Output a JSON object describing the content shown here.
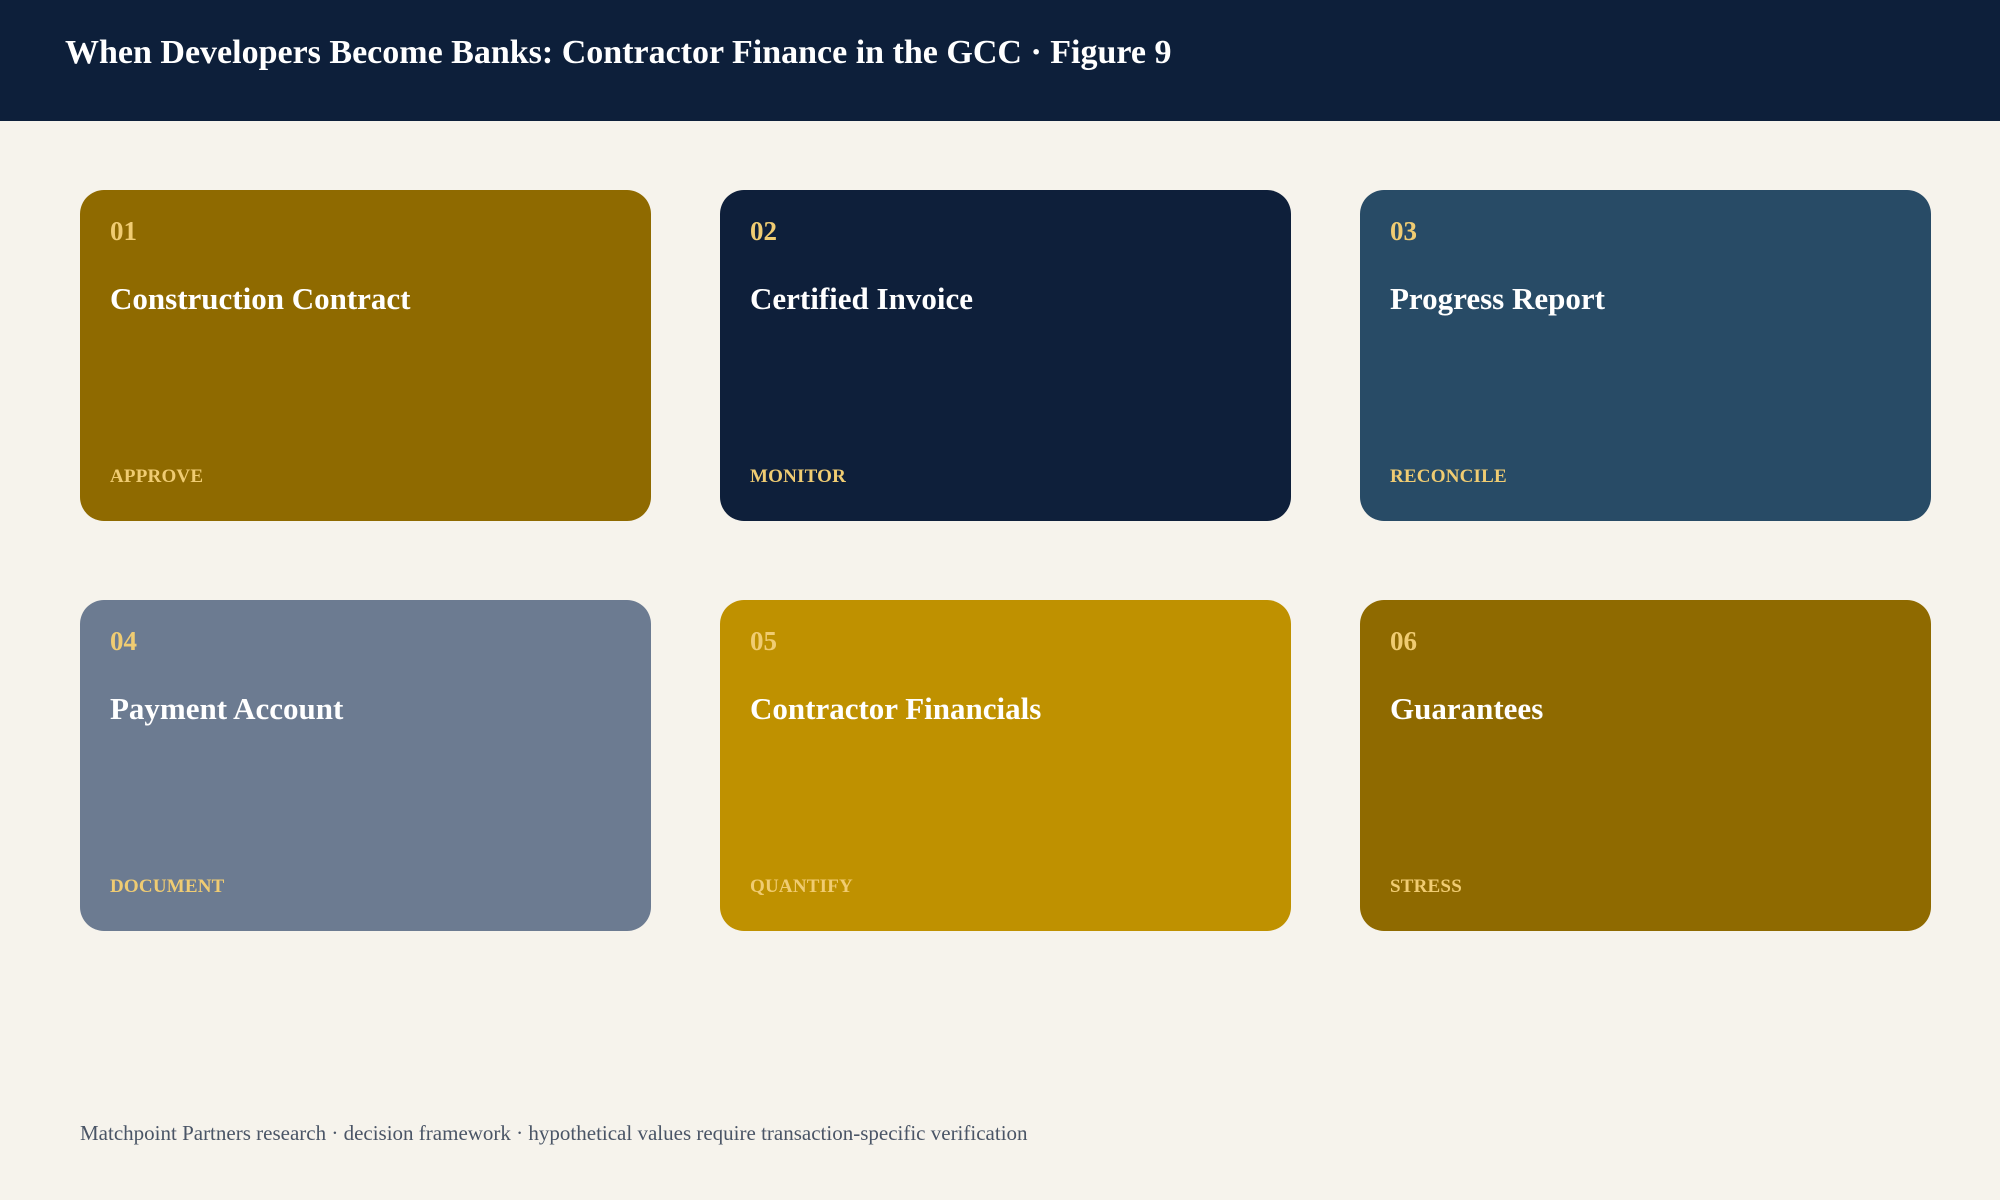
{
  "header": {
    "title": "When Developers Become Banks: Contractor Finance in the GCC · Figure 9"
  },
  "cards": [
    {
      "number": "01",
      "title": "Construction Contract",
      "action": "APPROVE",
      "color": "#8f6a00"
    },
    {
      "number": "02",
      "title": "Certified Invoice",
      "action": "MONITOR",
      "color": "#0e1f3a"
    },
    {
      "number": "03",
      "title": "Progress Report",
      "action": "RECONCILE",
      "color": "#284b66"
    },
    {
      "number": "04",
      "title": "Payment Account",
      "action": "DOCUMENT",
      "color": "#6c7b91"
    },
    {
      "number": "05",
      "title": "Contractor Financials",
      "action": "QUANTIFY",
      "color": "#bf9100"
    },
    {
      "number": "06",
      "title": "Guarantees",
      "action": "STRESS",
      "color": "#8f6a00"
    }
  ],
  "footer": {
    "text": "Matchpoint Partners research · decision framework · hypothetical values require transaction-specific verification"
  }
}
